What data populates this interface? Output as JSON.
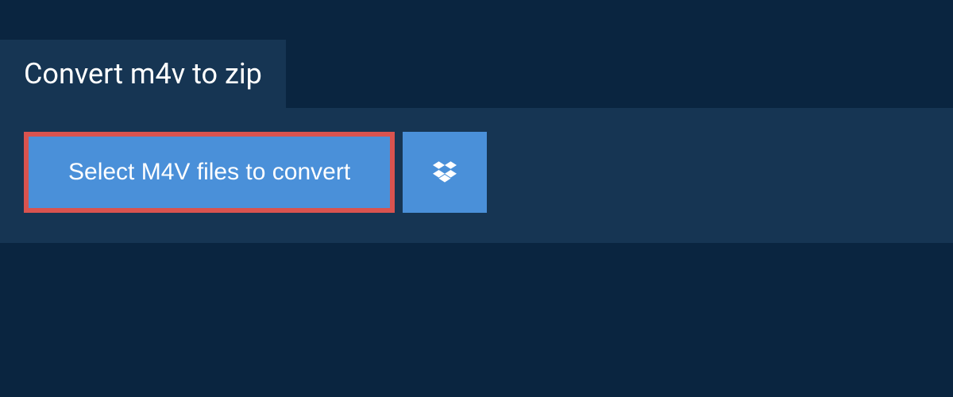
{
  "header": {
    "tab_title": "Convert m4v to zip"
  },
  "actions": {
    "select_button_label": "Select M4V files to convert"
  },
  "colors": {
    "background": "#0a2540",
    "panel": "#163553",
    "button": "#4a90d9",
    "highlight_border": "#d9534f",
    "text": "#ffffff"
  }
}
